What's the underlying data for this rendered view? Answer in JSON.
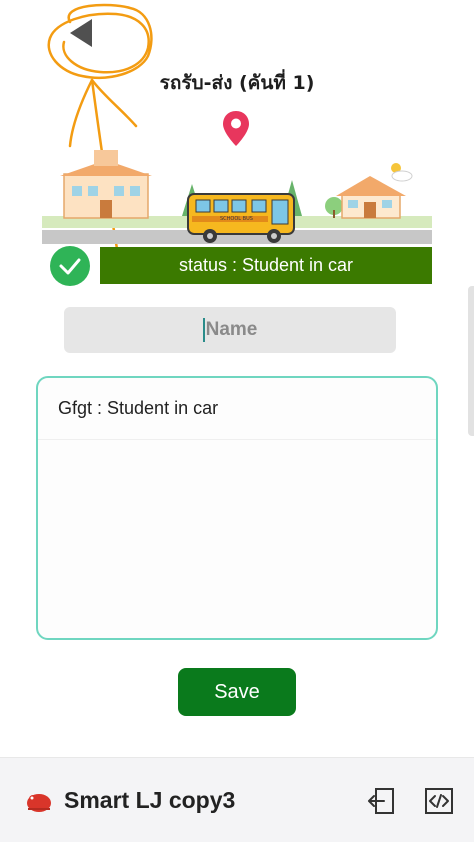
{
  "header": {
    "title": "รถรับ-ส่ง (คันที่ 1)",
    "back_icon": "back-triangle-icon"
  },
  "illustration": {
    "bus_text": "SCHOOL BUS",
    "location_icon": "map-pin-icon"
  },
  "status": {
    "text": "status : Student in car",
    "icon": "check-circle-icon",
    "color": "#3b7a00"
  },
  "name_input": {
    "placeholder": "Name",
    "value": ""
  },
  "list": {
    "items": [
      {
        "label": "Gfgt : Student in car"
      }
    ]
  },
  "actions": {
    "save_label": "Save",
    "save_color": "#0a7a1c"
  },
  "footer": {
    "app_name": "Smart LJ copy3",
    "exit_icon": "exit-icon",
    "code_icon": "code-icon"
  },
  "colors": {
    "accent": "#6fd6c0",
    "check": "#2fb457",
    "annotation": "#f39c12"
  }
}
